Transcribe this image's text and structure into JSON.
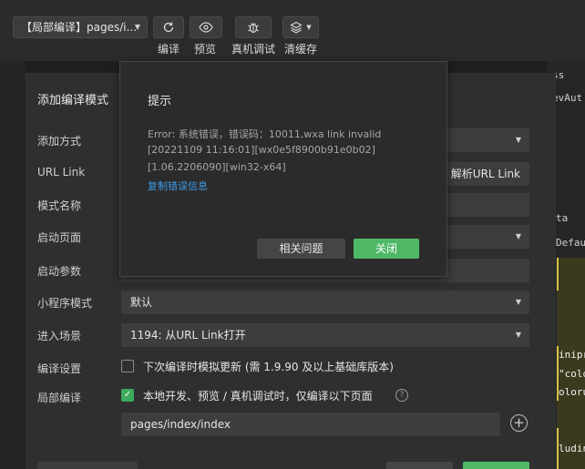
{
  "toolbar": {
    "mode_select": "【局部编译】pages/i...",
    "buttons": [
      {
        "label": "编译",
        "icon": "refresh-icon"
      },
      {
        "label": "预览",
        "icon": "eye-icon"
      },
      {
        "label": "真机调试",
        "icon": "bug-icon"
      },
      {
        "label": "清缓存",
        "icon": "layers-icon"
      }
    ]
  },
  "background_code": {
    "lines": [
      "ss",
      "evAut",
      "ta",
      "Defau",
      "iniprc",
      "\"colo",
      "oloru",
      "ludin"
    ]
  },
  "dialog": {
    "title": "添加编译模式",
    "labels": {
      "add_method": "添加方式",
      "url_link": "URL Link",
      "mode_name": "模式名称",
      "start_page": "启动页面",
      "start_params": "启动参数",
      "mini_mode": "小程序模式",
      "scene": "进入场景",
      "compile_settings": "编译设置",
      "partial_compile": "局部编译"
    },
    "parse_button": "解析URL Link",
    "mini_mode_value": "默认",
    "scene_value": "1194: 从URL Link打开",
    "compile_option": "下次编译时模拟更新 (需 1.9.90 及以上基础库版本)",
    "partial_option": "本地开发、预览 / 真机调试时，仅编译以下页面",
    "page_path": "pages/index/index"
  },
  "error_popup": {
    "title": "提示",
    "error_lines": [
      "Error: 系统错误，错误码：10011,wxa link invalid",
      "[20221109 11:16:01][wx0e5f8900b91e0b02]",
      "[1.06.2206090][win32-x64]"
    ],
    "copy_link": "复制错误信息",
    "related_button": "相关问题",
    "close_button": "关闭"
  },
  "colors": {
    "accent_green": "#4fb867",
    "link_blue": "#3e9be6"
  }
}
